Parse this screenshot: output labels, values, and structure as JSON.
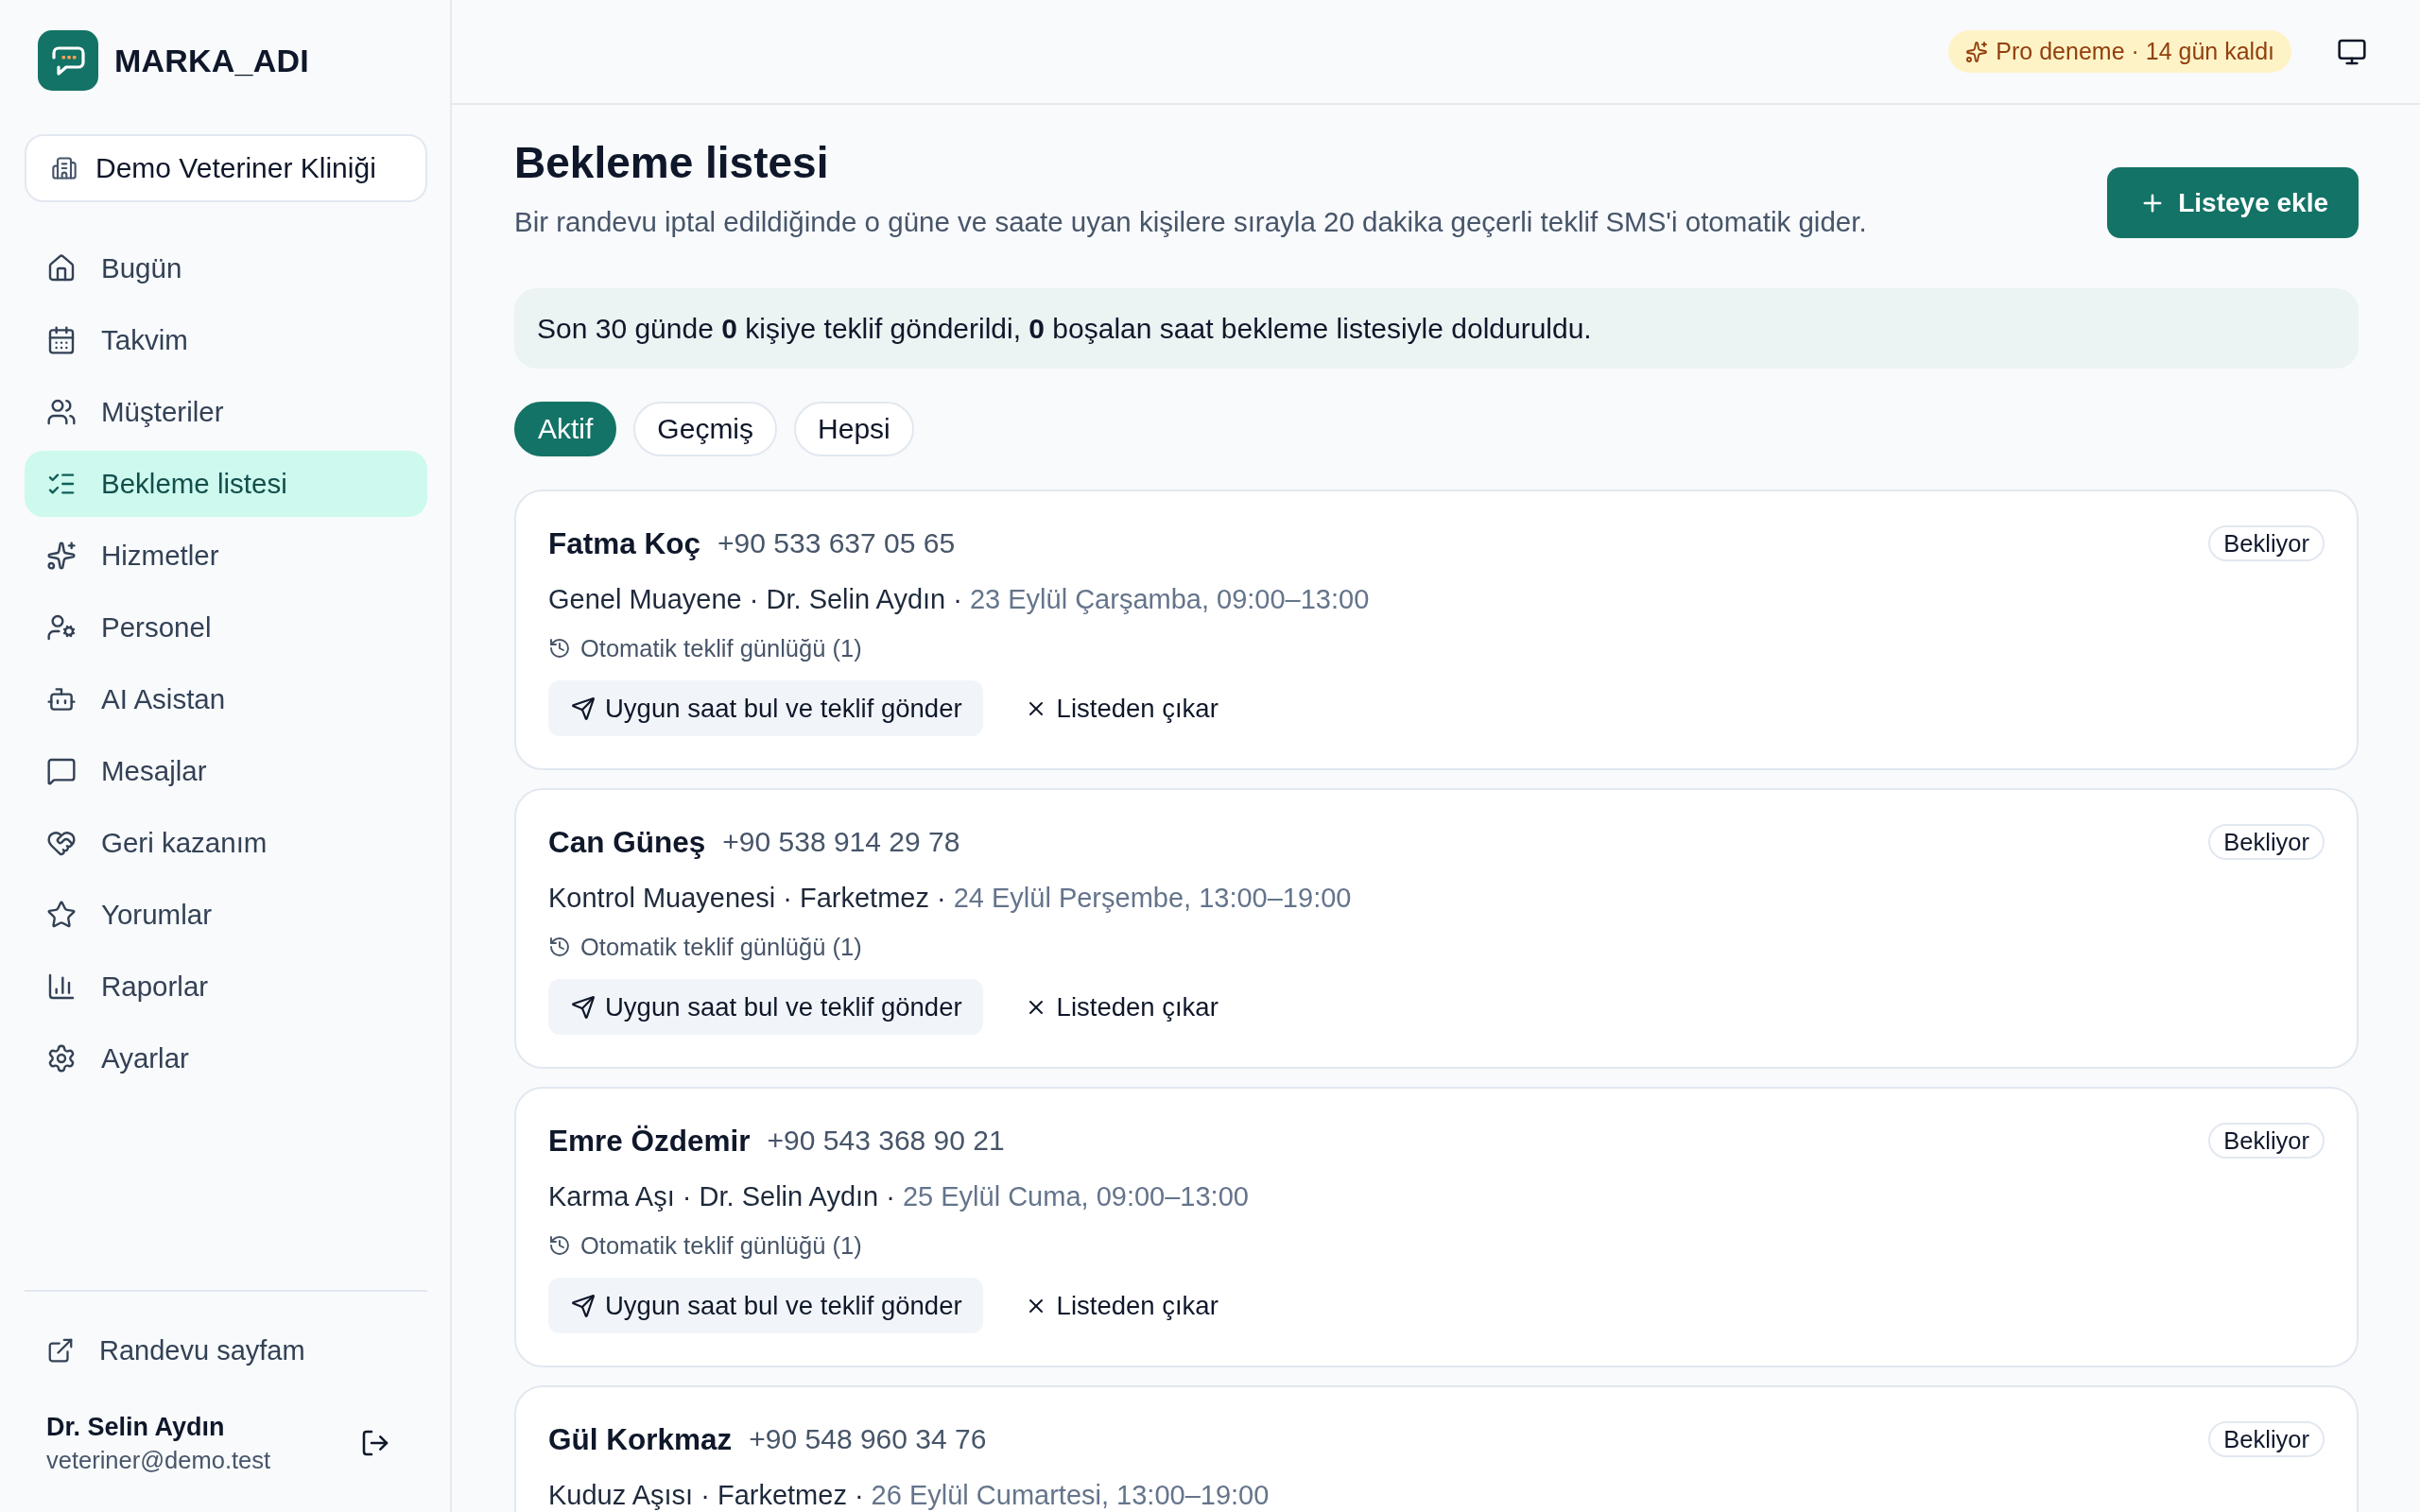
{
  "sidebar": {
    "brand": "MARKA_ADI",
    "workspace": "Demo Veteriner Kliniği",
    "items": [
      {
        "label": "Bugün",
        "selected": false
      },
      {
        "label": "Takvim",
        "selected": false
      },
      {
        "label": "Müşteriler",
        "selected": false
      },
      {
        "label": "Bekleme listesi",
        "selected": true
      },
      {
        "label": "Hizmetler",
        "selected": false
      },
      {
        "label": "Personel",
        "selected": false
      },
      {
        "label": "AI Asistan",
        "selected": false
      },
      {
        "label": "Mesajlar",
        "selected": false
      },
      {
        "label": "Geri kazanım",
        "selected": false
      },
      {
        "label": "Yorumlar",
        "selected": false
      },
      {
        "label": "Raporlar",
        "selected": false
      },
      {
        "label": "Ayarlar",
        "selected": false
      }
    ],
    "booking_link": "Randevu sayfam",
    "user": {
      "name": "Dr. Selin Aydın",
      "email": "veteriner@demo.test"
    }
  },
  "top_bar": {
    "trial_badge": "Pro deneme · 14 gün kaldı"
  },
  "page": {
    "title": "Bekleme listesi",
    "description": "Bir randevu iptal edildiğinde o güne ve saate uyan kişilere sırayla 20 dakika geçerli teklif SMS'i otomatik gider.",
    "add_button": "Listeye ekle",
    "summary": "Son 30 günde **0** kişiye teklif gönderildi, **0** boşalan saat bekleme listesiyle dolduruldu.",
    "filters": [
      {
        "label": "Aktif",
        "selected": true
      },
      {
        "label": "Geçmiş",
        "selected": false
      },
      {
        "label": "Hepsi",
        "selected": false
      }
    ]
  },
  "entries": [
    {
      "name": "Fatma Koç",
      "phone": "+90 533 637 05 65",
      "details": "Genel Muayene · Dr. Selin Aydın ·",
      "slot": "23 Eylül Çarşamba, 09:00–13:00",
      "log": "Otomatik teklif günlüğü (1)",
      "status": "Bekliyor",
      "actions": [
        {
          "kind": "find_slot",
          "label": "Uygun saat bul ve teklif gönder"
        },
        {
          "kind": "remove",
          "label": "Listeden çıkar"
        }
      ]
    },
    {
      "name": "Can Güneş",
      "phone": "+90 538 914 29 78",
      "details": "Kontrol Muayenesi · Farketmez ·",
      "slot": "24 Eylül Perşembe, 13:00–19:00",
      "log": "Otomatik teklif günlüğü (1)",
      "status": "Bekliyor",
      "actions": [
        {
          "kind": "find_slot",
          "label": "Uygun saat bul ve teklif gönder"
        },
        {
          "kind": "remove",
          "label": "Listeden çıkar"
        }
      ]
    },
    {
      "name": "Emre Özdemir",
      "phone": "+90 543 368 90 21",
      "details": "Karma Aşı · Dr. Selin Aydın ·",
      "slot": "25 Eylül Cuma, 09:00–13:00",
      "log": "Otomatik teklif günlüğü (1)",
      "status": "Bekliyor",
      "actions": [
        {
          "kind": "find_slot",
          "label": "Uygun saat bul ve teklif gönder"
        },
        {
          "kind": "remove",
          "label": "Listeden çıkar"
        }
      ]
    },
    {
      "name": "Gül Korkmaz",
      "phone": "+90 548 960 34 76",
      "details": "Kuduz Aşısı · Farketmez ·",
      "slot": "26 Eylül Cumartesi, 13:00–19:00",
      "status": "Bekliyor"
    }
  ]
}
